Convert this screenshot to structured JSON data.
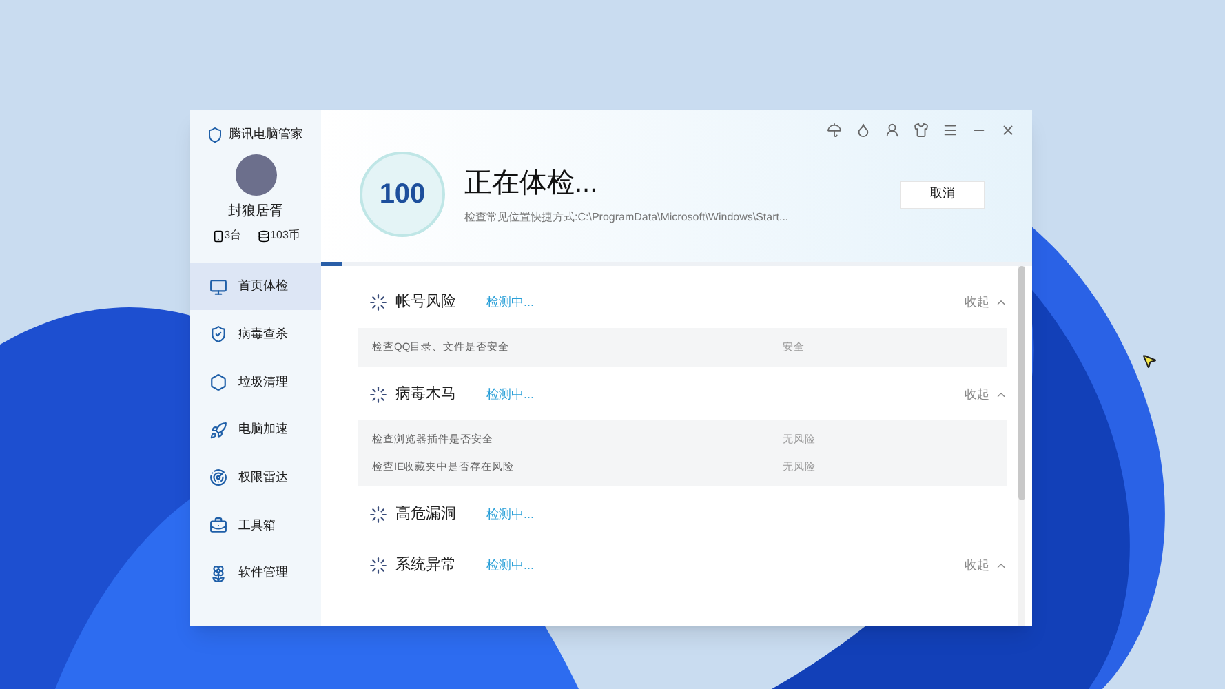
{
  "app": {
    "title": "腾讯电脑管家",
    "user": {
      "name": "封狼居胥",
      "devices": "3台",
      "coins": "103币"
    }
  },
  "sidebar": {
    "items": [
      {
        "label": "首页体检",
        "selected": true
      },
      {
        "label": "病毒查杀",
        "selected": false
      },
      {
        "label": "垃圾清理",
        "selected": false
      },
      {
        "label": "电脑加速",
        "selected": false
      },
      {
        "label": "权限雷达",
        "selected": false
      },
      {
        "label": "工具箱",
        "selected": false
      },
      {
        "label": "软件管理",
        "selected": false
      }
    ]
  },
  "header": {
    "score": "100",
    "title": "正在体检...",
    "detail": "检查常见位置快捷方式:C:\\ProgramData\\Microsoft\\Windows\\Start...",
    "cancel": "取消",
    "progress": {
      "level": 0.03
    }
  },
  "sections": [
    {
      "title": "帐号风险",
      "status": "检测中...",
      "toggle": "收起",
      "rows": [
        {
          "label": "检查QQ目录、文件是否安全",
          "result": "安全"
        }
      ]
    },
    {
      "title": "病毒木马",
      "status": "检测中...",
      "toggle": "收起",
      "rows": [
        {
          "label": "检查浏览器插件是否安全",
          "result": "无风险"
        },
        {
          "label": "检查IE收藏夹中是否存在风险",
          "result": "无风险"
        }
      ]
    },
    {
      "title": "高危漏洞",
      "status": "检测中..."
    },
    {
      "title": "系统异常",
      "status": "检测中...",
      "toggle": "收起"
    }
  ]
}
